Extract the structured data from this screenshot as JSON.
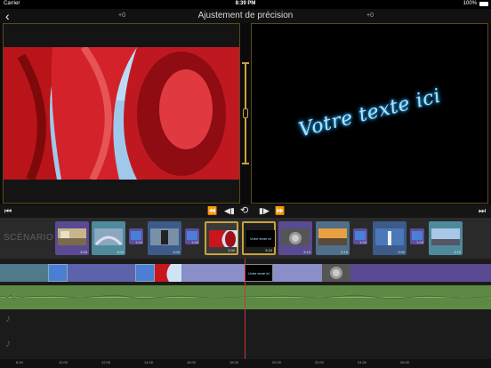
{
  "status_bar": {
    "carrier": "Carrier",
    "time": "8:39 PM",
    "battery": "100%"
  },
  "header": {
    "back_glyph": "‹",
    "title": "Ajustement de précision",
    "left_offset": "+0",
    "right_offset": "+0"
  },
  "preview": {
    "overlay_text": "Votre texte ici"
  },
  "storyboard": {
    "label": "SCÉNARIO",
    "items": [
      {
        "kind": "clip",
        "duration": "3.00"
      },
      {
        "kind": "clip",
        "duration": "3.00"
      },
      {
        "kind": "transition",
        "duration": "1.00"
      },
      {
        "kind": "clip",
        "duration": "3.00"
      },
      {
        "kind": "transition",
        "duration": "1.00"
      },
      {
        "kind": "clip",
        "duration": "2.00",
        "selected": true
      },
      {
        "kind": "clip",
        "duration": "3.10",
        "selected": true
      },
      {
        "kind": "clip",
        "duration": "3.10"
      },
      {
        "kind": "clip",
        "duration": "3.10"
      },
      {
        "kind": "transition",
        "duration": "1.00"
      },
      {
        "kind": "clip",
        "duration": "3.00"
      },
      {
        "kind": "transition",
        "duration": "1.00"
      },
      {
        "kind": "clip",
        "duration": "3.10"
      }
    ]
  },
  "title_clip_text": "Votre texte ici",
  "ruler": {
    "ticks": [
      "8.00",
      "10.00",
      "12.00",
      "14.00",
      "16.00",
      "18.00",
      "20.00",
      "22.00",
      "24.00",
      "26.00"
    ]
  },
  "colors": {
    "accent": "#c9a33a",
    "video_track": "#5d63ab",
    "audio_track": "#5c8a44",
    "transition": "#5e4d9e",
    "playhead": "#cc3333"
  }
}
